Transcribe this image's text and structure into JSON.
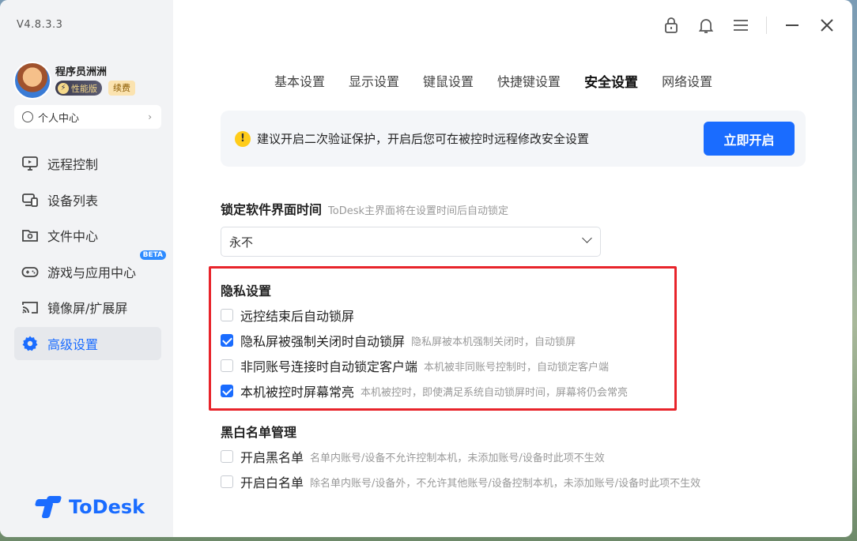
{
  "app": {
    "version": "V4.8.3.3",
    "logo_text": "ToDesk"
  },
  "user": {
    "name": "程序员洲洲",
    "tier_badge": "性能版",
    "renew_badge": "续费",
    "personal_center": "个人中心"
  },
  "sidebar": {
    "items": [
      {
        "label": "远程控制",
        "icon": "monitor-icon",
        "active": false
      },
      {
        "label": "设备列表",
        "icon": "devices-icon",
        "active": false
      },
      {
        "label": "文件中心",
        "icon": "folder-icon",
        "active": false
      },
      {
        "label": "游戏与应用中心",
        "icon": "gamepad-icon",
        "active": false,
        "badge": "BETA"
      },
      {
        "label": "镜像屏/扩展屏",
        "icon": "cast-icon",
        "active": false
      },
      {
        "label": "高级设置",
        "icon": "gear-icon",
        "active": true
      }
    ]
  },
  "tabs": [
    {
      "label": "基本设置",
      "active": false
    },
    {
      "label": "显示设置",
      "active": false
    },
    {
      "label": "键鼠设置",
      "active": false
    },
    {
      "label": "快捷键设置",
      "active": false
    },
    {
      "label": "安全设置",
      "active": true
    },
    {
      "label": "网络设置",
      "active": false
    }
  ],
  "notice": {
    "message": "建议开启二次验证保护，开启后您可在被控时远程修改安全设置",
    "button": "立即开启"
  },
  "lock_time": {
    "title": "锁定软件界面时间",
    "hint": "ToDesk主界面将在设置时间后自动锁定",
    "value": "永不"
  },
  "privacy": {
    "title": "隐私设置",
    "options": [
      {
        "label": "远控结束后自动锁屏",
        "desc": "",
        "checked": false
      },
      {
        "label": "隐私屏被强制关闭时自动锁屏",
        "desc": "隐私屏被本机强制关闭时，自动锁屏",
        "checked": true
      },
      {
        "label": "非同账号连接时自动锁定客户端",
        "desc": "本机被非同账号控制时，自动锁定客户端",
        "checked": false
      },
      {
        "label": "本机被控时屏幕常亮",
        "desc": "本机被控时，即使满足系统自动锁屏时间，屏幕将仍会常亮",
        "checked": true
      }
    ]
  },
  "blackwhite": {
    "title": "黑白名单管理",
    "options": [
      {
        "label": "开启黑名单",
        "desc": "名单内账号/设备不允许控制本机，未添加账号/设备时此项不生效",
        "checked": false
      },
      {
        "label": "开启白名单",
        "desc": "除名单内账号/设备外，不允许其他账号/设备控制本机，未添加账号/设备时此项不生效",
        "checked": false
      }
    ]
  },
  "colors": {
    "accent": "#1a6cff",
    "highlight_border": "#e8242b",
    "warning": "#ffcc1a"
  }
}
